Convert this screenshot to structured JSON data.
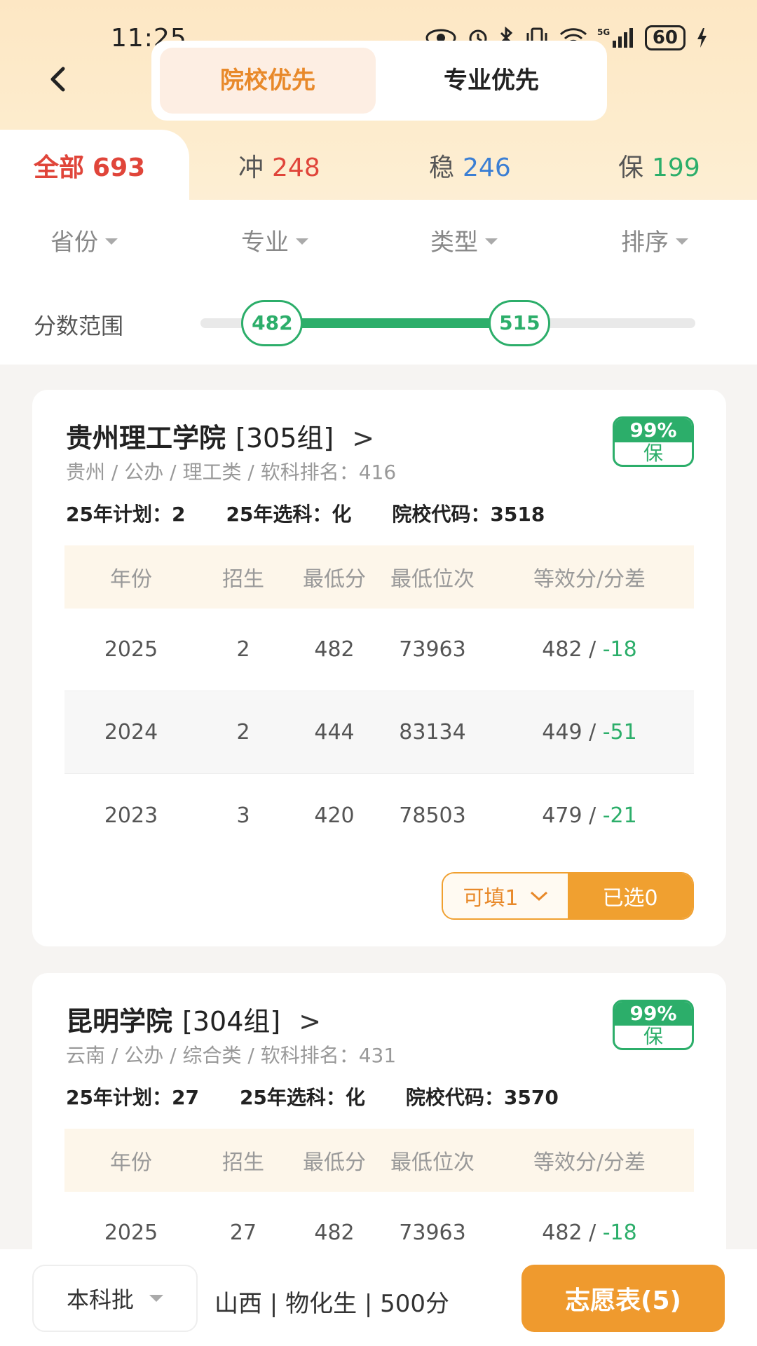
{
  "status_bar": {
    "time": "11:25",
    "battery": "60"
  },
  "header": {
    "back_icon": "chevron-left-icon",
    "tabs": [
      {
        "label": "院校优先",
        "active": true
      },
      {
        "label": "专业优先",
        "active": false
      }
    ]
  },
  "filter_tabs": [
    {
      "label": "全部",
      "count": "693",
      "color": "#e0453a",
      "active": true
    },
    {
      "label": "冲",
      "count": "248",
      "color": "#e0453a",
      "active": false
    },
    {
      "label": "稳",
      "count": "246",
      "color": "#3b7fd4",
      "active": false
    },
    {
      "label": "保",
      "count": "199",
      "color": "#2cae6a",
      "active": false
    }
  ],
  "dropdowns": [
    "省份",
    "专业",
    "类型",
    "排序"
  ],
  "score_range": {
    "label": "分数范围",
    "min": "482",
    "max": "515",
    "low_fraction": 0.145,
    "high_fraction": 0.645,
    "accent": "#2cae6a"
  },
  "table_headers": [
    "年份",
    "招生",
    "最低分",
    "最低位次",
    "等效分/分差"
  ],
  "cards": [
    {
      "name": "贵州理工学院",
      "group": "[305组]",
      "chevron": ">",
      "meta": "贵州 / 公办 / 理工类 / 软科排名：416",
      "plan": "25年计划：2",
      "subject": "25年选科：化",
      "code": "院校代码：3518",
      "probability": "99%",
      "level": "保",
      "rows": [
        {
          "year": "2025",
          "enroll": "2",
          "min_score": "482",
          "min_rank": "73963",
          "eq": "482 / ",
          "diff": "-18"
        },
        {
          "year": "2024",
          "enroll": "2",
          "min_score": "444",
          "min_rank": "83134",
          "eq": "449 / ",
          "diff": "-51"
        },
        {
          "year": "2023",
          "enroll": "3",
          "min_score": "420",
          "min_rank": "78503",
          "eq": "479 / ",
          "diff": "-21"
        }
      ],
      "fillable": "可填1",
      "selected": "已选0"
    },
    {
      "name": "昆明学院",
      "group": "[304组]",
      "chevron": ">",
      "meta": "云南 / 公办 / 综合类 / 软科排名：431",
      "plan": "25年计划：27",
      "subject": "25年选科：化",
      "code": "院校代码：3570",
      "probability": "99%",
      "level": "保",
      "rows": [
        {
          "year": "2025",
          "enroll": "27",
          "min_score": "482",
          "min_rank": "73963",
          "eq": "482 / ",
          "diff": "-18"
        }
      ]
    }
  ],
  "bottom_bar": {
    "batch": "本科批",
    "user_info": "山西 | 物化生 | 500分",
    "wish_button": "志愿表(5)"
  }
}
